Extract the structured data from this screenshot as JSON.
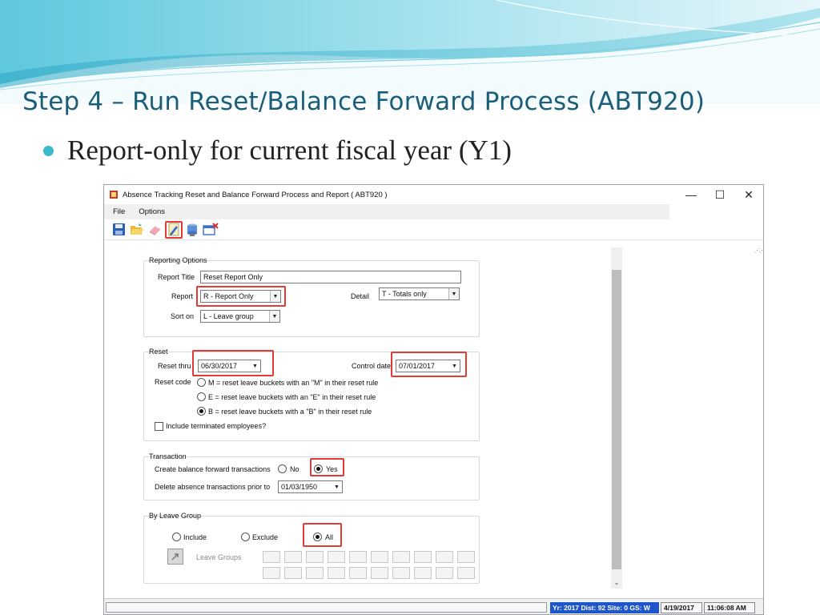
{
  "slide": {
    "title": "Step 4 – Run Reset/Balance Forward Process (ABT920)",
    "bullet": "Report-only for current fiscal year (Y1)",
    "colors": {
      "title": "#1b5e7a",
      "bullet": "#3bb8c9",
      "highlight": "#e53935",
      "status_blue": "#1e56c9"
    }
  },
  "window": {
    "title": "Absence Tracking Reset and Balance Forward Process and Report ( ABT920 )",
    "controls": {
      "minimize": "—",
      "maximize": "☐",
      "close": "✕"
    },
    "menu": [
      "File",
      "Options"
    ],
    "toolbar": [
      {
        "icon": "save-icon"
      },
      {
        "icon": "open-folder-icon"
      },
      {
        "icon": "eraser-icon"
      },
      {
        "icon": "run-report-icon",
        "highlighted": true
      },
      {
        "icon": "database-icon"
      },
      {
        "icon": "exit-icon"
      }
    ]
  },
  "reporting_options": {
    "group_title": "Reporting Options",
    "report_title_label": "Report Title",
    "report_title_value": "Reset Report Only",
    "report_label": "Report",
    "report_value": "R - Report Only",
    "detail_label": "Detail",
    "detail_value": "T - Totals only",
    "sort_label": "Sort on",
    "sort_value": "L - Leave group"
  },
  "reset": {
    "group_title": "Reset",
    "reset_thru_label": "Reset thru",
    "reset_thru_value": "06/30/2017",
    "control_date_label": "Control date",
    "control_date_value": "07/01/2017",
    "reset_code_label": "Reset code",
    "options": [
      {
        "label": "M = reset leave buckets with an \"M\" in their reset rule",
        "checked": false
      },
      {
        "label": "E = reset leave buckets with an \"E\" in their reset rule",
        "checked": false
      },
      {
        "label": "B = reset leave buckets with a \"B\" in their reset rule",
        "checked": true
      }
    ],
    "include_terminated_label": "Include terminated employees?",
    "include_terminated_checked": false
  },
  "transaction": {
    "group_title": "Transaction",
    "create_label": "Create balance forward transactions",
    "no_label": "No",
    "yes_label": "Yes",
    "selected": "Yes",
    "delete_label": "Delete absence transactions prior to",
    "delete_value": "01/03/1950"
  },
  "leave_group": {
    "group_title": "By Leave Group",
    "include_label": "Include",
    "exclude_label": "Exclude",
    "all_label": "All",
    "selected": "All",
    "leave_groups_label": "Leave Groups"
  },
  "status": {
    "info": "Yr: 2017 Dist: 92 Site: 0 GS: W",
    "date": "4/19/2017",
    "time": "11:06:08 AM"
  }
}
